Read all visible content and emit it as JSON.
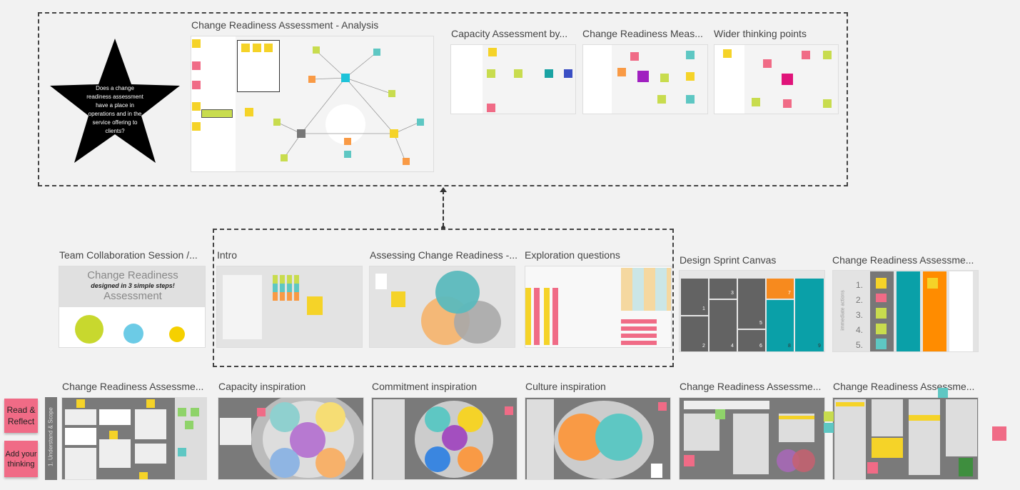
{
  "colors": {
    "yellow": "#f5d328",
    "green": "#c8dc4e",
    "teal": "#5ec7c3",
    "orange": "#f99a45",
    "pink": "#f06b86",
    "purple": "#a34fbf",
    "gray": "#7a7a7a",
    "cyan": "#1ec3d9"
  },
  "star": {
    "text": "Does a change readiness assessment have a place in operations and in the service offering to clients?"
  },
  "top_frames": [
    {
      "title": "Change Readiness Assessment - Analysis"
    },
    {
      "title": "Capacity Assessment by..."
    },
    {
      "title": "Change Readiness Meas..."
    },
    {
      "title": "Wider thinking points"
    }
  ],
  "middle_frames": [
    {
      "title": "Team Collaboration Session /...",
      "heading": "Change Readiness",
      "subheading": "designed in 3 simple steps!",
      "heading2": "Assessment"
    },
    {
      "title": "Intro"
    },
    {
      "title": "Assessing Change Readiness -..."
    },
    {
      "title": "Exploration questions"
    },
    {
      "title": "Design Sprint Canvas",
      "numbers": [
        "1",
        "2",
        "3",
        "4",
        "5",
        "6",
        "7",
        "8",
        "9"
      ]
    },
    {
      "title": "Change Readiness Assessme...",
      "side_label": "immediate actions",
      "numbers": [
        "1.",
        "2.",
        "3.",
        "4.",
        "5."
      ]
    }
  ],
  "bottom_frames": [
    {
      "title": "Change Readiness Assessme..."
    },
    {
      "title": "Capacity inspiration"
    },
    {
      "title": "Commitment inspiration"
    },
    {
      "title": "Culture inspiration"
    },
    {
      "title": "Change Readiness Assessme..."
    },
    {
      "title": "Change Readiness Assessme..."
    }
  ],
  "stickies": {
    "read_reflect": "Read & Reflect",
    "add_thinking": "Add your thinking"
  },
  "stage_label": "1. Understand & Scope"
}
